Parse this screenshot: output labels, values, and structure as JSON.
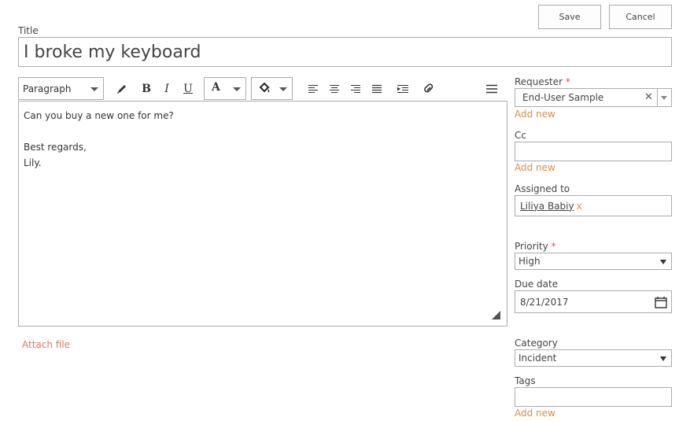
{
  "toolbar": {
    "save_label": "Save",
    "cancel_label": "Cancel"
  },
  "title": {
    "label": "Title",
    "value": "I broke my keyboard"
  },
  "editor": {
    "paragraph_style": "Paragraph",
    "icons": [
      "pencil-icon",
      "bold-icon",
      "italic-icon",
      "underline-icon",
      "font-color-icon",
      "highlight-icon",
      "align-left-icon",
      "align-center-icon",
      "align-right-icon",
      "justify-icon",
      "indent-icon",
      "link-icon",
      "more-icon"
    ],
    "bold": "B",
    "italic": "I",
    "underline": "U",
    "font_color_glyph": "A",
    "lines": [
      "Can you buy a new one for me?",
      "",
      "Best regards,",
      "Lily."
    ]
  },
  "attach_label": "Attach file",
  "requester": {
    "label": "Requester",
    "required_mark": "*",
    "value": "End-User Sample",
    "add_new": "Add new"
  },
  "cc": {
    "label": "Cc",
    "value": "",
    "add_new": "Add new"
  },
  "assigned_to": {
    "label": "Assigned to",
    "value": "Liliya Babiy",
    "remove": "x"
  },
  "priority": {
    "label": "Priority",
    "required_mark": "*",
    "value": "High"
  },
  "due_date": {
    "label": "Due date",
    "value": "8/21/2017"
  },
  "category": {
    "label": "Category",
    "value": "Incident"
  },
  "tags": {
    "label": "Tags",
    "value": "",
    "add_new": "Add new"
  },
  "colors": {
    "link": "#d98e4b",
    "required": "#d9534f",
    "border": "#ababab"
  }
}
